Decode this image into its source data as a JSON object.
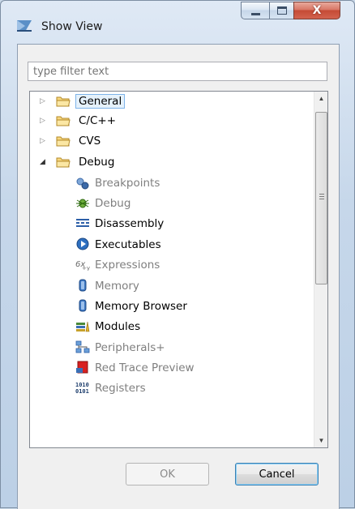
{
  "window": {
    "title": "Show View",
    "close_glyph": "X"
  },
  "filter": {
    "placeholder": "type filter text"
  },
  "tree": {
    "categories": [
      {
        "label": "General",
        "expanded": false,
        "selected": true
      },
      {
        "label": "C/C++",
        "expanded": false
      },
      {
        "label": "CVS",
        "expanded": false
      },
      {
        "label": "Debug",
        "expanded": true
      }
    ],
    "debug_items": [
      {
        "label": "Breakpoints",
        "enabled": false,
        "icon": "breakpoints-icon"
      },
      {
        "label": "Debug",
        "enabled": false,
        "icon": "bug-icon"
      },
      {
        "label": "Disassembly",
        "enabled": true,
        "icon": "disassembly-icon"
      },
      {
        "label": "Executables",
        "enabled": true,
        "icon": "executables-icon"
      },
      {
        "label": "Expressions",
        "enabled": false,
        "icon": "expressions-icon"
      },
      {
        "label": "Memory",
        "enabled": false,
        "icon": "memory-icon"
      },
      {
        "label": "Memory Browser",
        "enabled": true,
        "icon": "memory-browser-icon"
      },
      {
        "label": "Modules",
        "enabled": true,
        "icon": "modules-icon"
      },
      {
        "label": "Peripherals+",
        "enabled": false,
        "icon": "peripherals-icon"
      },
      {
        "label": "Red Trace Preview",
        "enabled": false,
        "icon": "red-trace-icon"
      },
      {
        "label": "Registers",
        "enabled": false,
        "icon": "registers-icon"
      }
    ]
  },
  "buttons": {
    "ok_label": "OK",
    "cancel_label": "Cancel"
  },
  "colors": {
    "selection_bg": "#e5f1fb",
    "selection_border": "#7eb4ea",
    "disabled_text": "#7f7f7f",
    "folder": "#f0c75e"
  }
}
